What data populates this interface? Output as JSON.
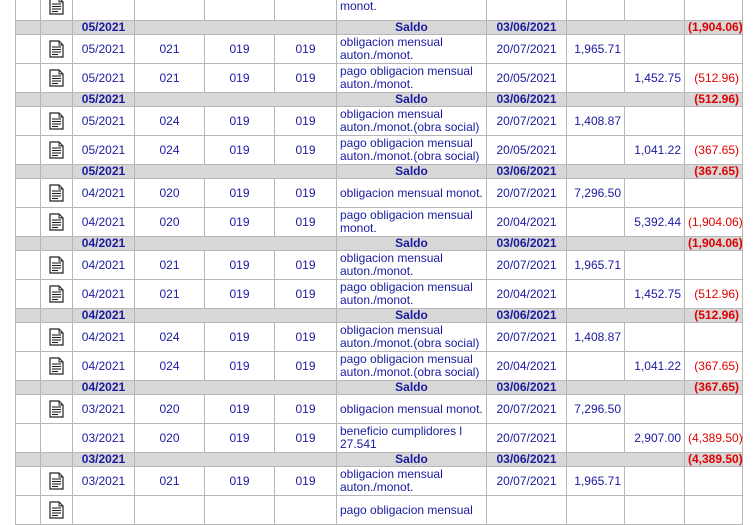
{
  "rows": [
    {
      "kind": "data",
      "icon": true,
      "periodo": "",
      "c1": "",
      "c2": "",
      "c3": "",
      "desc": "monot.",
      "fecha": "",
      "debe": "",
      "haber": "",
      "saldo": ""
    },
    {
      "kind": "saldo",
      "periodo": "05/2021",
      "label": "Saldo",
      "fecha": "03/06/2021",
      "saldo": "(1,904.06)"
    },
    {
      "kind": "data",
      "icon": true,
      "periodo": "05/2021",
      "c1": "021",
      "c2": "019",
      "c3": "019",
      "desc": "obligacion mensual auton./monot.",
      "fecha": "20/07/2021",
      "debe": "1,965.71",
      "haber": "",
      "saldo": ""
    },
    {
      "kind": "data",
      "icon": true,
      "periodo": "05/2021",
      "c1": "021",
      "c2": "019",
      "c3": "019",
      "desc": "pago obligacion mensual auton./monot.",
      "fecha": "20/05/2021",
      "debe": "",
      "haber": "1,452.75",
      "saldo": "(512.96)"
    },
    {
      "kind": "saldo",
      "periodo": "05/2021",
      "label": "Saldo",
      "fecha": "03/06/2021",
      "saldo": "(512.96)"
    },
    {
      "kind": "data",
      "icon": true,
      "periodo": "05/2021",
      "c1": "024",
      "c2": "019",
      "c3": "019",
      "desc": "obligacion mensual auton./monot.(obra social)",
      "fecha": "20/07/2021",
      "debe": "1,408.87",
      "haber": "",
      "saldo": ""
    },
    {
      "kind": "data",
      "icon": true,
      "periodo": "05/2021",
      "c1": "024",
      "c2": "019",
      "c3": "019",
      "desc": "pago obligacion mensual auton./monot.(obra social)",
      "fecha": "20/05/2021",
      "debe": "",
      "haber": "1,041.22",
      "saldo": "(367.65)"
    },
    {
      "kind": "saldo",
      "periodo": "05/2021",
      "label": "Saldo",
      "fecha": "03/06/2021",
      "saldo": "(367.65)"
    },
    {
      "kind": "data",
      "icon": true,
      "periodo": "04/2021",
      "c1": "020",
      "c2": "019",
      "c3": "019",
      "desc": "obligacion mensual monot.",
      "fecha": "20/07/2021",
      "debe": "7,296.50",
      "haber": "",
      "saldo": ""
    },
    {
      "kind": "data",
      "icon": true,
      "periodo": "04/2021",
      "c1": "020",
      "c2": "019",
      "c3": "019",
      "desc": "pago obligacion mensual monot.",
      "fecha": "20/04/2021",
      "debe": "",
      "haber": "5,392.44",
      "saldo": "(1,904.06)"
    },
    {
      "kind": "saldo",
      "periodo": "04/2021",
      "label": "Saldo",
      "fecha": "03/06/2021",
      "saldo": "(1,904.06)"
    },
    {
      "kind": "data",
      "icon": true,
      "periodo": "04/2021",
      "c1": "021",
      "c2": "019",
      "c3": "019",
      "desc": "obligacion mensual auton./monot.",
      "fecha": "20/07/2021",
      "debe": "1,965.71",
      "haber": "",
      "saldo": ""
    },
    {
      "kind": "data",
      "icon": true,
      "periodo": "04/2021",
      "c1": "021",
      "c2": "019",
      "c3": "019",
      "desc": "pago obligacion mensual auton./monot.",
      "fecha": "20/04/2021",
      "debe": "",
      "haber": "1,452.75",
      "saldo": "(512.96)"
    },
    {
      "kind": "saldo",
      "periodo": "04/2021",
      "label": "Saldo",
      "fecha": "03/06/2021",
      "saldo": "(512.96)"
    },
    {
      "kind": "data",
      "icon": true,
      "periodo": "04/2021",
      "c1": "024",
      "c2": "019",
      "c3": "019",
      "desc": "obligacion mensual auton./monot.(obra social)",
      "fecha": "20/07/2021",
      "debe": "1,408.87",
      "haber": "",
      "saldo": ""
    },
    {
      "kind": "data",
      "icon": true,
      "periodo": "04/2021",
      "c1": "024",
      "c2": "019",
      "c3": "019",
      "desc": "pago obligacion mensual auton./monot.(obra social)",
      "fecha": "20/04/2021",
      "debe": "",
      "haber": "1,041.22",
      "saldo": "(367.65)"
    },
    {
      "kind": "saldo",
      "periodo": "04/2021",
      "label": "Saldo",
      "fecha": "03/06/2021",
      "saldo": "(367.65)"
    },
    {
      "kind": "data",
      "icon": true,
      "periodo": "03/2021",
      "c1": "020",
      "c2": "019",
      "c3": "019",
      "desc": "obligacion mensual monot.",
      "fecha": "20/07/2021",
      "debe": "7,296.50",
      "haber": "",
      "saldo": ""
    },
    {
      "kind": "data",
      "icon": false,
      "periodo": "03/2021",
      "c1": "020",
      "c2": "019",
      "c3": "019",
      "desc": "beneficio cumplidores l 27.541",
      "fecha": "20/07/2021",
      "debe": "",
      "haber": "2,907.00",
      "saldo": "(4,389.50)"
    },
    {
      "kind": "saldo",
      "periodo": "03/2021",
      "label": "Saldo",
      "fecha": "03/06/2021",
      "saldo": "(4,389.50)"
    },
    {
      "kind": "data",
      "icon": true,
      "periodo": "03/2021",
      "c1": "021",
      "c2": "019",
      "c3": "019",
      "desc": "obligacion mensual auton./monot.",
      "fecha": "20/07/2021",
      "debe": "1,965.71",
      "haber": "",
      "saldo": ""
    },
    {
      "kind": "data",
      "icon": true,
      "periodo": "",
      "c1": "",
      "c2": "",
      "c3": "",
      "desc": "pago obligacion mensual",
      "fecha": "",
      "debe": "",
      "haber": "",
      "saldo": ""
    }
  ]
}
